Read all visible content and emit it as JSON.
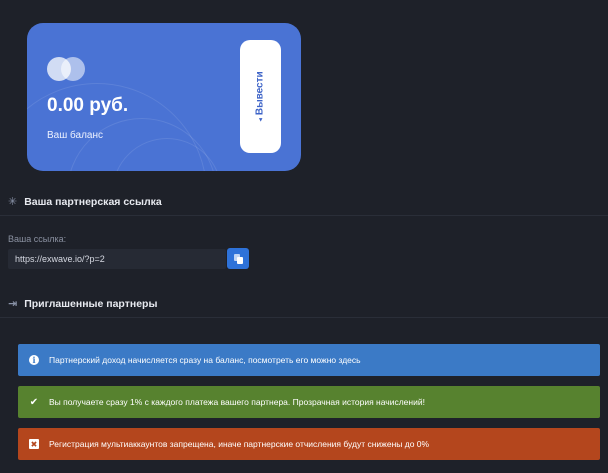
{
  "balance_card": {
    "amount": "0.00 руб.",
    "label": "Ваш баланс",
    "withdraw_label": "Вывести",
    "withdraw_arrow": "◂"
  },
  "affiliate_link_section": {
    "icon": "asterisk-icon",
    "icon_glyph": "✳",
    "title": "Ваша партнерская ссылка",
    "field_label": "Ваша ссылка:",
    "link_value": "https://exwave.io/?p=2"
  },
  "invited_partners_section": {
    "icon": "sign-in-icon",
    "icon_glyph": "⇥",
    "title": "Приглашенные партнеры"
  },
  "alerts": {
    "info": {
      "icon_glyph": "i",
      "text": "Партнерский доход начисляется сразу на баланс, посмотреть его можно здесь",
      "color": "#3b7ac6"
    },
    "success": {
      "icon_glyph": "✔",
      "text": "Вы получаете сразу 1% с каждого платежа вашего партнера. Прозрачная история начислений!",
      "color": "#57822f"
    },
    "danger": {
      "icon_glyph": "✖",
      "text": "Регистрация мультиаккаунтов запрещена, иначе партнерские отчисления будут снижены до 0%",
      "color": "#b4461d"
    }
  },
  "colors": {
    "background": "#1e2129",
    "card": "#4a73d4",
    "accent": "#2e72d9"
  }
}
